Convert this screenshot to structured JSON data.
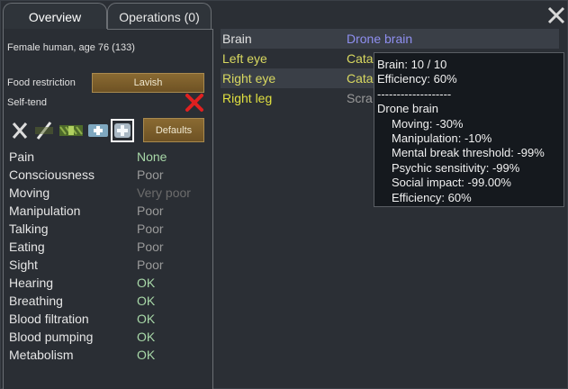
{
  "tabs": {
    "overview": "Overview",
    "operations": "Operations (0)"
  },
  "pawn": {
    "description": "Female human, age 76 (133)"
  },
  "food": {
    "label": "Food restriction",
    "value": "Lavish"
  },
  "selftend": {
    "label": "Self-tend",
    "state_icon": "red-x-icon"
  },
  "defaults_label": "Defaults",
  "quick_icons": [
    "x-icon",
    "slash-icon",
    "medicine-herbal-icon",
    "medicine-industrial-icon",
    "medicine-glitter-icon"
  ],
  "capacities": [
    {
      "name": "Pain",
      "value": "None"
    },
    {
      "name": "Consciousness",
      "value": "Poor"
    },
    {
      "name": "Moving",
      "value": "Very poor"
    },
    {
      "name": "Manipulation",
      "value": "Poor"
    },
    {
      "name": "Talking",
      "value": "Poor"
    },
    {
      "name": "Eating",
      "value": "Poor"
    },
    {
      "name": "Sight",
      "value": "Poor"
    },
    {
      "name": "Hearing",
      "value": "OK"
    },
    {
      "name": "Breathing",
      "value": "OK"
    },
    {
      "name": "Blood filtration",
      "value": "OK"
    },
    {
      "name": "Blood pumping",
      "value": "OK"
    },
    {
      "name": "Metabolism",
      "value": "OK"
    }
  ],
  "parts": [
    {
      "name": "Brain",
      "value": "Drone brain",
      "name_color": "#e0e0e0",
      "value_color": "#8f8ff0"
    },
    {
      "name": "Left eye",
      "value": "Cata",
      "name_color": "#d8d860",
      "value_color": "#d8d860"
    },
    {
      "name": "Right eye",
      "value": "Cata",
      "name_color": "#d8d860",
      "value_color": "#d8d860"
    },
    {
      "name": "Right leg",
      "value": "Scra",
      "name_color": "#e0e040",
      "value_color": "#9a9a9a"
    }
  ],
  "tooltip": {
    "lines": [
      "Brain:  10 / 10",
      "Efficiency: 60%",
      "-------------------",
      "Drone brain",
      "Moving: -30%",
      "Manipulation: -10%",
      "Mental break threshold: -99%",
      "Psychic sensitivity: -99%",
      "Social impact: -99.00%",
      "Efficiency: 60%"
    ]
  }
}
